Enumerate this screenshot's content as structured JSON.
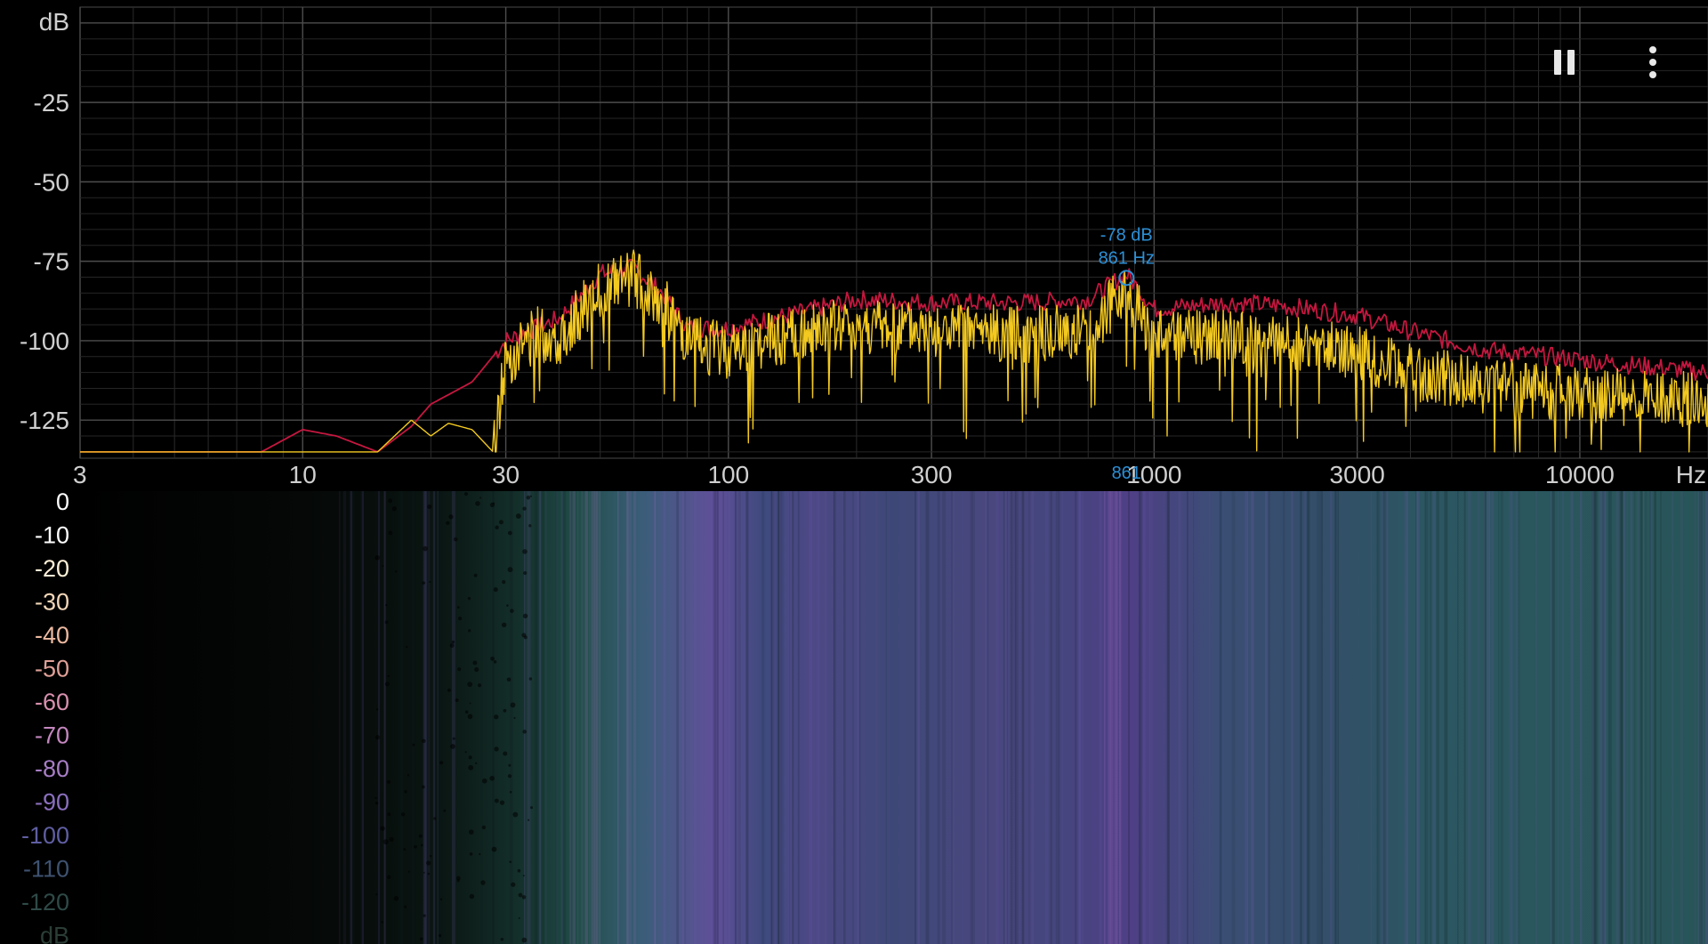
{
  "toolbar": {
    "pause_icon": "pause-icon",
    "more_icon": "more-vert-icon"
  },
  "spectrum": {
    "y_unit": "dB",
    "x_unit": "Hz",
    "y_ticks": [
      "-25",
      "-50",
      "-75",
      "-100",
      "-125"
    ],
    "x_ticks": [
      "3",
      "10",
      "30",
      "100",
      "300",
      "1000",
      "3000",
      "10000"
    ],
    "peak": {
      "db_label": "-78 dB",
      "hz_label": "861 Hz",
      "hz": 861,
      "db": -78,
      "axis_marker": "861"
    },
    "colors": {
      "current": "#f3c920",
      "peak_hold": "#c4173f",
      "grid": "#3a3a3a",
      "marker": "#2c8fd6"
    }
  },
  "spectrogram": {
    "scale_labels": [
      "0",
      "-10",
      "-20",
      "-30",
      "-40",
      "-50",
      "-60",
      "-70",
      "-80",
      "-90",
      "-100",
      "-110",
      "-120",
      "dB"
    ],
    "scale_colors": [
      "#ffffff",
      "#ffffff",
      "#fff0d8",
      "#f3d7b8",
      "#ecb9a0",
      "#e0a098",
      "#d890ae",
      "#c487bf",
      "#a77ec6",
      "#8a6fbe",
      "#5f5ea2",
      "#3e5270",
      "#2e4a47",
      "#2b3e36"
    ]
  },
  "chart_data": {
    "type": "line",
    "title": "",
    "xlabel": "Hz",
    "ylabel": "dB",
    "xscale": "log",
    "xlim": [
      3,
      20000
    ],
    "ylim": [
      -137,
      5
    ],
    "grid": true,
    "series": [
      {
        "color": "#c4173f",
        "x": [
          3,
          8,
          10,
          12,
          15,
          18,
          20,
          25,
          30,
          40,
          50,
          60,
          70,
          80,
          100,
          150,
          200,
          300,
          500,
          700,
          861,
          1000,
          1500,
          2000,
          3000,
          4000,
          6000,
          10000,
          20000
        ],
        "y": [
          -135,
          -135,
          -128,
          -130,
          -135,
          -127,
          -120,
          -113,
          -100,
          -93,
          -79,
          -77,
          -85,
          -96,
          -96,
          -91,
          -87,
          -88,
          -88,
          -87,
          -79,
          -90,
          -88,
          -89,
          -92,
          -97,
          -103,
          -106,
          -110
        ]
      },
      {
        "color": "#f3c920",
        "x": [
          3,
          15,
          18,
          20,
          22,
          25,
          28,
          30,
          35,
          40,
          50,
          60,
          70,
          80,
          100,
          150,
          200,
          300,
          500,
          700,
          861,
          1000,
          1500,
          2000,
          3000,
          4000,
          6000,
          10000,
          20000
        ],
        "y": [
          -135,
          -135,
          -125,
          -130,
          -126,
          -128,
          -135,
          -106,
          -98,
          -99,
          -84,
          -80,
          -88,
          -101,
          -103,
          -98,
          -95,
          -97,
          -98,
          -97,
          -84,
          -99,
          -99,
          -101,
          -104,
          -110,
          -114,
          -117,
          -119
        ]
      }
    ]
  }
}
